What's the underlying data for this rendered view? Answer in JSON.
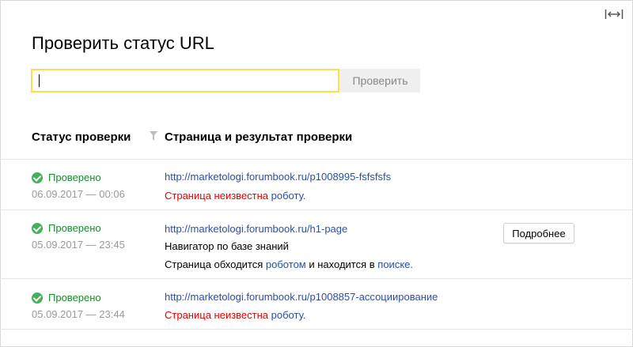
{
  "header": {
    "title": "Проверить статус URL"
  },
  "search": {
    "value": "",
    "button_label": "Проверить"
  },
  "table": {
    "col_status": "Статус проверки",
    "col_page": "Страница и результат проверки",
    "rows": [
      {
        "status": "Проверено",
        "timestamp": "06.09.2017 — 00:06",
        "url": "http://marketologi.forumbook.ru/p1008995-fsfsfsfs",
        "result_red": "Страница неизвестна",
        "result_link": "роботу",
        "result_tail": "."
      },
      {
        "status": "Проверено",
        "timestamp": "05.09.2017 — 23:45",
        "url": "http://marketologi.forumbook.ru/h1-page",
        "page_title": "Навигатор по базе знаний",
        "result_prefix": "Страница обходится",
        "result_link1": "роботом",
        "result_mid": "и находится в",
        "result_link2": "поиске",
        "result_tail": ".",
        "details_label": "Подробнее"
      },
      {
        "status": "Проверено",
        "timestamp": "05.09.2017 — 23:44",
        "url": "http://marketologi.forumbook.ru/p1008857-ассоциирование",
        "result_red": "Страница неизвестна",
        "result_link": "роботу",
        "result_tail": "."
      }
    ]
  },
  "colors": {
    "accent_input": "#ffdb4d",
    "ok_green": "#1a8a2e",
    "link_blue": "#2a4fa8",
    "error_red": "#e60000"
  },
  "icons": {
    "expand": "expand-icon",
    "filter": "filter-icon",
    "ok": "check-circle-icon"
  }
}
